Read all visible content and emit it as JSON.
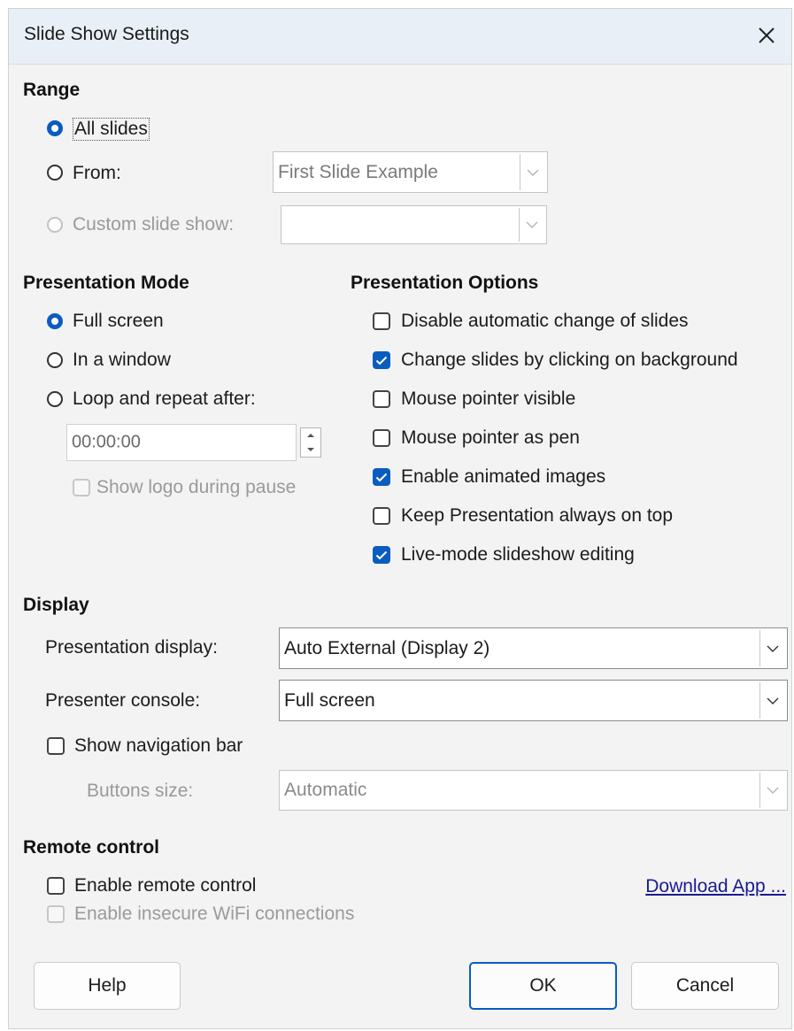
{
  "window": {
    "title": "Slide Show Settings"
  },
  "range": {
    "heading": "Range",
    "all_slides": "All slides",
    "from_label": "From:",
    "from_value": "First Slide Example",
    "custom_label": "Custom slide show:",
    "custom_value": ""
  },
  "presentation_mode": {
    "heading": "Presentation Mode",
    "full_screen": "Full screen",
    "in_window": "In a window",
    "loop": "Loop and repeat after:",
    "loop_time": "00:00:00",
    "show_logo": "Show logo during pause"
  },
  "presentation_options": {
    "heading": "Presentation Options",
    "items": [
      {
        "label": "Disable automatic change of slides",
        "checked": false
      },
      {
        "label": "Change slides by clicking on background",
        "checked": true
      },
      {
        "label": "Mouse pointer visible",
        "checked": false
      },
      {
        "label": "Mouse pointer as pen",
        "checked": false
      },
      {
        "label": "Enable animated images",
        "checked": true
      },
      {
        "label": "Keep Presentation always on top",
        "checked": false
      },
      {
        "label": "Live-mode slideshow editing",
        "checked": true
      }
    ]
  },
  "display": {
    "heading": "Display",
    "presentation_display_label": "Presentation display:",
    "presentation_display_value": "Auto External (Display 2)",
    "presenter_console_label": "Presenter console:",
    "presenter_console_value": "Full screen",
    "show_nav_bar": "Show navigation bar",
    "buttons_size_label": "Buttons size:",
    "buttons_size_value": "Automatic"
  },
  "remote": {
    "heading": "Remote control",
    "enable_remote": "Enable remote control",
    "enable_insecure": "Enable insecure WiFi connections",
    "download_link": "Download App ..."
  },
  "buttons": {
    "help": "Help",
    "ok": "OK",
    "cancel": "Cancel"
  },
  "colors": {
    "accent": "#0b5cbf",
    "link": "#1b1b8f"
  }
}
